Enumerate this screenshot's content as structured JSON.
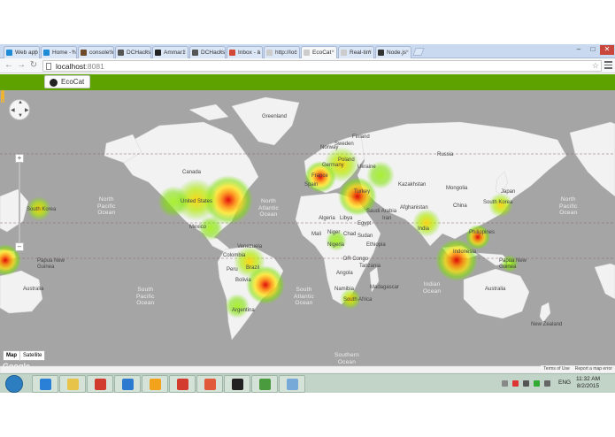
{
  "browser": {
    "tabs": [
      {
        "label": "Web app",
        "favicon": "windows-icon",
        "color": "#1e8bd6"
      },
      {
        "label": "Home - h",
        "favicon": "windows-icon",
        "color": "#1e8bd6"
      },
      {
        "label": "console.lo",
        "favicon": "app-icon",
        "color": "#6e4a2c"
      },
      {
        "label": "DCHacks",
        "favicon": "doc-icon",
        "color": "#555555"
      },
      {
        "label": "Ammar1",
        "favicon": "github-icon",
        "color": "#222222"
      },
      {
        "label": "DCHacks",
        "favicon": "doc-icon",
        "color": "#555555"
      },
      {
        "label": "Inbox - a",
        "favicon": "gmail-icon",
        "color": "#d14836"
      },
      {
        "label": "http://loc",
        "favicon": "page-icon",
        "color": "#cccccc"
      },
      {
        "label": "EcoCat",
        "favicon": "page-icon",
        "color": "#cccccc",
        "active": true
      },
      {
        "label": "Real-tim",
        "favicon": "page-icon",
        "color": "#cccccc"
      },
      {
        "label": "Node.js",
        "favicon": "node-icon",
        "color": "#333333"
      }
    ],
    "url_host": "localhost",
    "url_port": ":8081",
    "window_controls": {
      "minimize": "–",
      "maximize": "□",
      "close": "✕"
    }
  },
  "app": {
    "brand_label": "EcoCat",
    "header_color": "#5ea200"
  },
  "map": {
    "ocean_color": "#a5a5a5",
    "land_color": "#f2f2f2",
    "oceans": [
      {
        "name": "north-pacific-left",
        "text": "North\nPacific\nOcean"
      },
      {
        "name": "north-atlantic",
        "text": "North\nAtlantic\nOcean"
      },
      {
        "name": "north-pacific-right",
        "text": "North\nPacific\nOcean"
      },
      {
        "name": "south-pacific",
        "text": "South\nPacific\nOcean"
      },
      {
        "name": "south-atlantic",
        "text": "South\nAtlantic\nOcean"
      },
      {
        "name": "indian",
        "text": "Indian\nOcean"
      },
      {
        "name": "southern",
        "text": "Southern\nOcean"
      }
    ],
    "place_labels": [
      {
        "name": "greenland",
        "text": "Greenland"
      },
      {
        "name": "canada",
        "text": "Canada"
      },
      {
        "name": "united-states",
        "text": "United States"
      },
      {
        "name": "mexico",
        "text": "Mexico"
      },
      {
        "name": "venezuela",
        "text": "Venezuela"
      },
      {
        "name": "colombia",
        "text": "Colombia"
      },
      {
        "name": "brazil",
        "text": "Brazil"
      },
      {
        "name": "peru",
        "text": "Peru"
      },
      {
        "name": "bolivia",
        "text": "Bolivia"
      },
      {
        "name": "argentina",
        "text": "Argentina"
      },
      {
        "name": "finland",
        "text": "Finland"
      },
      {
        "name": "russia",
        "text": "Russia"
      },
      {
        "name": "kazakhstan",
        "text": "Kazakhstan"
      },
      {
        "name": "mongolia",
        "text": "Mongolia"
      },
      {
        "name": "china",
        "text": "China"
      },
      {
        "name": "afghanistan",
        "text": "Afghanistan"
      },
      {
        "name": "iran",
        "text": "Iran"
      },
      {
        "name": "india",
        "text": "India"
      },
      {
        "name": "algeria",
        "text": "Algeria"
      },
      {
        "name": "libya",
        "text": "Libya"
      },
      {
        "name": "egypt",
        "text": "Egypt"
      },
      {
        "name": "mali",
        "text": "Mali"
      },
      {
        "name": "niger",
        "text": "Niger"
      },
      {
        "name": "chad",
        "text": "Chad"
      },
      {
        "name": "sudan",
        "text": "Sudan"
      },
      {
        "name": "nigeria",
        "text": "Nigeria"
      },
      {
        "name": "ethiopia",
        "text": "Ethiopia"
      },
      {
        "name": "dr-congo",
        "text": "DR Congo"
      },
      {
        "name": "tanzania",
        "text": "Tanzania"
      },
      {
        "name": "angola",
        "text": "Angola"
      },
      {
        "name": "namibia",
        "text": "Namibia"
      },
      {
        "name": "south-africa",
        "text": "South Africa"
      },
      {
        "name": "madagascar",
        "text": "Madagascar"
      },
      {
        "name": "australia-right",
        "text": "Australia"
      },
      {
        "name": "australia-left",
        "text": "Australia"
      },
      {
        "name": "papua-new-guinea-right",
        "text": "Papua New\nGuinea"
      },
      {
        "name": "papua-new-guinea-left",
        "text": "Papua New\nGuinea"
      },
      {
        "name": "indonesia",
        "text": "Indonesia"
      },
      {
        "name": "philippines",
        "text": "Philippines"
      },
      {
        "name": "japan",
        "text": "Japan"
      },
      {
        "name": "south-korea",
        "text": "South Korea"
      },
      {
        "name": "south-korea-left",
        "text": "South Korea"
      },
      {
        "name": "saudi-arabia",
        "text": "Saudi Arabia"
      },
      {
        "name": "turkey",
        "text": "Turkey"
      },
      {
        "name": "poland",
        "text": "Poland"
      },
      {
        "name": "ukraine",
        "text": "Ukraine"
      },
      {
        "name": "germany",
        "text": "Germany"
      },
      {
        "name": "france",
        "text": "France"
      },
      {
        "name": "spain",
        "text": "Spain"
      },
      {
        "name": "sweden",
        "text": "Sweden"
      },
      {
        "name": "norway",
        "text": "Norway"
      },
      {
        "name": "new-zealand",
        "text": "New Zealand"
      }
    ],
    "map_type": {
      "map": "Map",
      "satellite": "Satellite"
    },
    "google_logo": "Google",
    "attribution": {
      "terms": "Terms of Use",
      "report": "Report a map error"
    },
    "heatmap_legend_colors": [
      "#7be000",
      "#ffe600",
      "#ff8a00",
      "#e00000"
    ]
  },
  "taskbar": {
    "apps": [
      {
        "name": "internet-explorer",
        "icon": "ie-icon",
        "color": "#2a7fd6"
      },
      {
        "name": "file-explorer",
        "icon": "folder-icon",
        "color": "#e8c34a"
      },
      {
        "name": "app-red",
        "icon": "app-icon",
        "color": "#d13b2e"
      },
      {
        "name": "app-blue",
        "icon": "app-icon",
        "color": "#2c7bd0"
      },
      {
        "name": "app-gauge",
        "icon": "gauge-icon",
        "color": "#f3a21b"
      },
      {
        "name": "chrome",
        "icon": "chrome-icon",
        "color": "#d33b2f"
      },
      {
        "name": "app-grid",
        "icon": "grid-icon",
        "color": "#e05a3a"
      },
      {
        "name": "terminal",
        "icon": "terminal-icon",
        "color": "#222222"
      },
      {
        "name": "app-image",
        "icon": "image-icon",
        "color": "#4a9b3e"
      },
      {
        "name": "app-box",
        "icon": "box-icon",
        "color": "#76a8d8"
      }
    ],
    "language": "ENG",
    "time": "11:32 AM",
    "date": "8/2/2015"
  }
}
